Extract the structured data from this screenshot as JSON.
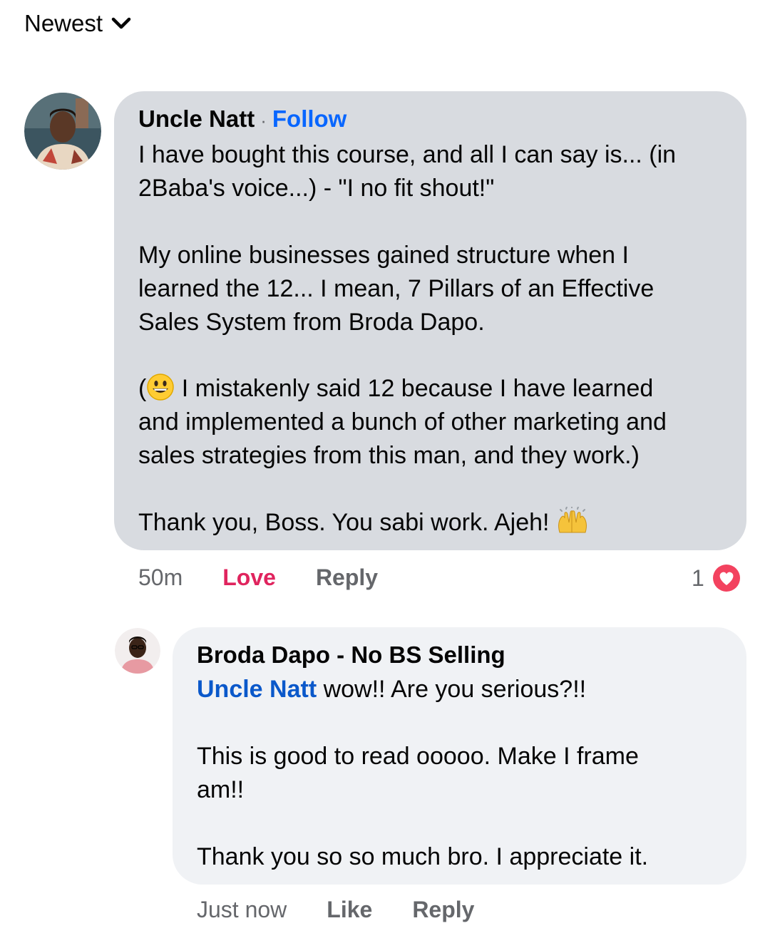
{
  "sort": {
    "label": "Newest"
  },
  "comment": {
    "author": "Uncle Natt",
    "separator": "·",
    "follow_label": "Follow",
    "p1": "I have bought this course, and all I can say is... (in\n2Baba's voice...) - \"I no fit shout!\"",
    "p2": "My online businesses gained structure when I\nlearned the 12... I mean, 7 Pillars of an Effective\nSales System from Broda Dapo.",
    "p3_open": "(",
    "p3_rest": " I mistakenly said 12 because I have learned",
    "p3_cont": "and implemented a bunch of other marketing and\nsales strategies from this man, and they work.)",
    "p4": "Thank you, Boss. You sabi work. Ajeh! ",
    "time": "50m",
    "love_label": "Love",
    "reply_label": "Reply",
    "reaction_count": "1",
    "accent_color": "#0866ff",
    "love_color": "#e0245e"
  },
  "reply": {
    "author": "Broda Dapo - No BS Selling",
    "mention": "Uncle Natt",
    "p1_rest": " wow!! Are you serious?!!",
    "p2": "This is good to read ooooo. Make I frame\nam!!",
    "p3": "Thank you so so much bro. I appreciate it.",
    "time": "Just now",
    "like_label": "Like",
    "reply_label": "Reply"
  },
  "icons": {
    "sort": "chevron-down-icon",
    "grin": "grinning-face-emoji",
    "hands": "raising-hands-emoji",
    "heart": "heart-reaction-icon"
  }
}
